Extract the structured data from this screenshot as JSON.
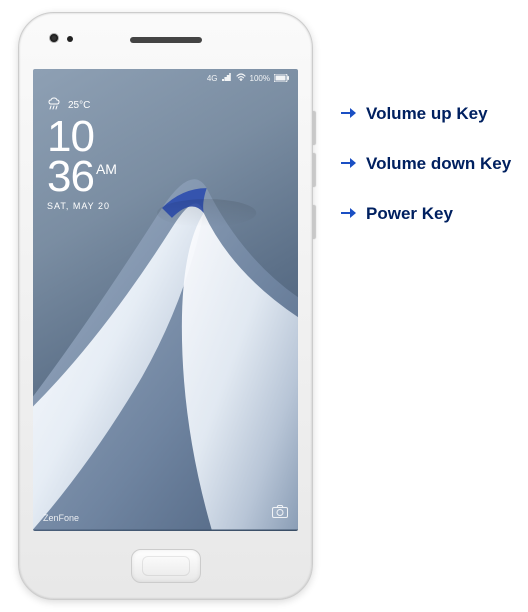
{
  "labels": {
    "volume_up": "Volume up Key",
    "volume_down": "Volume down Key",
    "power": "Power Key"
  },
  "screen": {
    "status": {
      "network": "4G",
      "battery": "100%"
    },
    "weather": {
      "temp": "25°C",
      "icon": "cloud-rain"
    },
    "clock": {
      "hours": "10",
      "minutes": "36",
      "ampm": "AM",
      "date": "SAT, MAY 20"
    },
    "brand": "ZenFone"
  }
}
